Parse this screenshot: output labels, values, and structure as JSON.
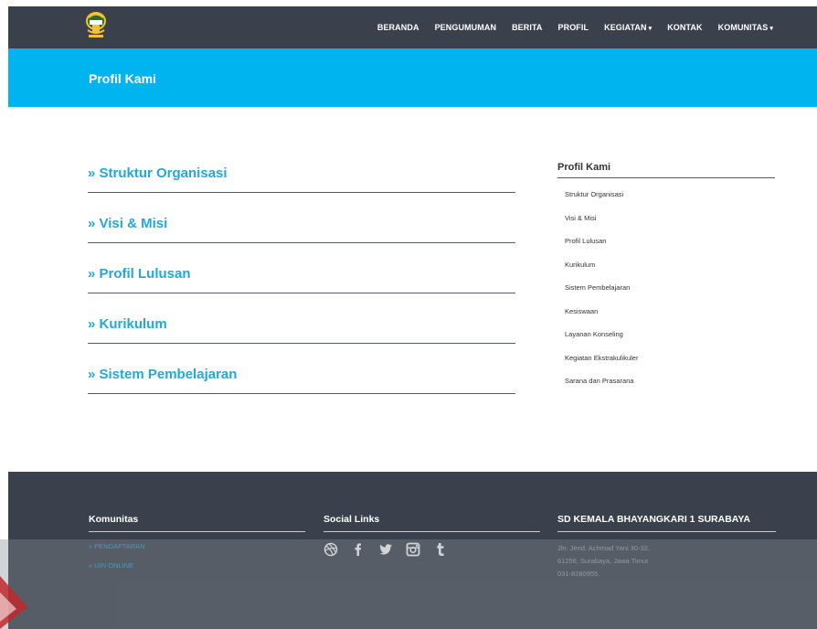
{
  "nav": {
    "items": [
      {
        "label": "BERANDA",
        "caret": ""
      },
      {
        "label": "PENGUMUMAN",
        "caret": ""
      },
      {
        "label": "BERITA",
        "caret": ""
      },
      {
        "label": "PROFIL",
        "caret": ""
      },
      {
        "label": "KEGIATAN",
        "caret": "▾"
      },
      {
        "label": "KONTAK",
        "caret": ""
      },
      {
        "label": "KOMUNITAS",
        "caret": "▾"
      }
    ]
  },
  "hero": {
    "title": "Profil Kami"
  },
  "main": {
    "items": [
      {
        "label": "» Struktur Organisasi"
      },
      {
        "label": "» Visi & Misi"
      },
      {
        "label": "» Profil Lulusan"
      },
      {
        "label": "» Kurikulum"
      },
      {
        "label": "» Sistem Pembelajaran"
      }
    ]
  },
  "sidebar": {
    "title": "Profil Kami",
    "items": [
      {
        "label": "Struktur Organisasi"
      },
      {
        "label": "Visi & Misi"
      },
      {
        "label": "Profil Lulusan"
      },
      {
        "label": "Kurikulum"
      },
      {
        "label": "Sistem Pembelajaran"
      },
      {
        "label": "Kesiswaan"
      },
      {
        "label": "Layanan Konseling"
      },
      {
        "label": "Kegiatan Ekstrakulikuler"
      },
      {
        "label": "Sarana dan Prasarana"
      }
    ]
  },
  "footer": {
    "komunitas": {
      "title": "Komunitas",
      "links": [
        {
          "label": "» PENDAFTARAN"
        },
        {
          "label": "» UIN ONLINE"
        }
      ]
    },
    "social": {
      "title": "Social Links",
      "icons": [
        "dribbble-icon",
        "facebook-icon",
        "twitter-icon",
        "instagram-icon",
        "tumblr-icon"
      ]
    },
    "school": {
      "title": "SD KEMALA BHAYANGKARI 1 SURABAYA",
      "address_lines": [
        "Jln. Jend. Achmad Yani 30-32,",
        "61256, Surabaya, Jawa Timur",
        "031-8280955."
      ]
    }
  },
  "colors": {
    "navbar": "#3a414c",
    "hero": "#00b4ef",
    "link_accent": "#20a9d9",
    "footer": "#3a414c"
  }
}
